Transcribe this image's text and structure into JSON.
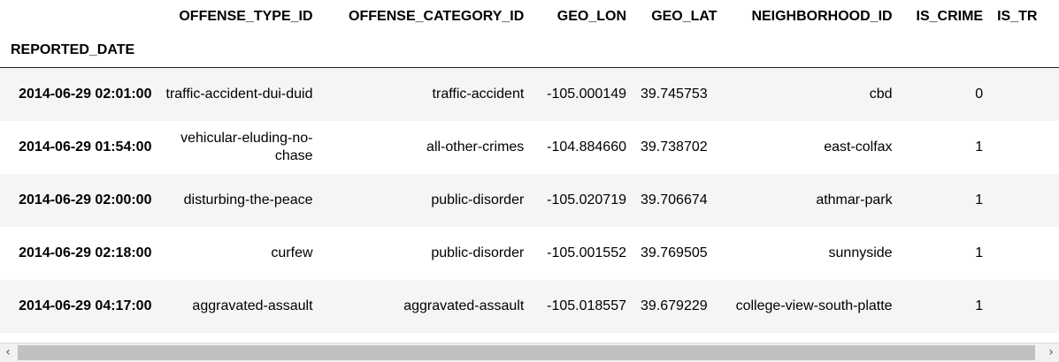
{
  "table": {
    "index_name": "REPORTED_DATE",
    "columns": [
      "OFFENSE_TYPE_ID",
      "OFFENSE_CATEGORY_ID",
      "GEO_LON",
      "GEO_LAT",
      "NEIGHBORHOOD_ID",
      "IS_CRIME",
      "IS_TR"
    ],
    "rows": [
      {
        "index": "2014-06-29 02:01:00",
        "cells": [
          "traffic-accident-dui-duid",
          "traffic-accident",
          "-105.000149",
          "39.745753",
          "cbd",
          "0",
          ""
        ]
      },
      {
        "index": "2014-06-29 01:54:00",
        "cells": [
          "vehicular-eluding-no-chase",
          "all-other-crimes",
          "-104.884660",
          "39.738702",
          "east-colfax",
          "1",
          ""
        ]
      },
      {
        "index": "2014-06-29 02:00:00",
        "cells": [
          "disturbing-the-peace",
          "public-disorder",
          "-105.020719",
          "39.706674",
          "athmar-park",
          "1",
          ""
        ]
      },
      {
        "index": "2014-06-29 02:18:00",
        "cells": [
          "curfew",
          "public-disorder",
          "-105.001552",
          "39.769505",
          "sunnyside",
          "1",
          ""
        ]
      },
      {
        "index": "2014-06-29 04:17:00",
        "cells": [
          "aggravated-assault",
          "aggravated-assault",
          "-105.018557",
          "39.679229",
          "college-view-south-platte",
          "1",
          ""
        ]
      }
    ]
  },
  "scrollbar": {
    "left_arrow": "‹",
    "right_arrow": "›"
  }
}
